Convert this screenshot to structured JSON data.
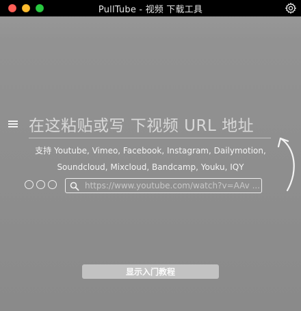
{
  "window": {
    "title": "PullTube - 视频 下载工具",
    "controls": [
      "close",
      "minimize",
      "zoom"
    ]
  },
  "icons": {
    "settings": "gear-icon",
    "menu": "hamburger-menu-icon",
    "search": "search-icon",
    "paste_hint": "curved-arrow-icon"
  },
  "main": {
    "headline": "在这粘贴或写 下视频 URL 地址",
    "supports_line1": "支持 Youtube, Vimeo, Facebook, Instagram, Dailymotion,",
    "supports_line2": "Soundcloud, Mixcloud, Bandcamp, Youku, IQY"
  },
  "search": {
    "value": "",
    "placeholder": "https://www.youtube.com/watch?v=AAv ..."
  },
  "tutorial_button": {
    "label": "显示入门教程"
  },
  "colors": {
    "background": "#8d8d8d",
    "titlebar": "#000000",
    "close": "#ff5f57",
    "minimize": "#febc2e",
    "zoom": "#28c840",
    "button": "#c2c2c2"
  }
}
